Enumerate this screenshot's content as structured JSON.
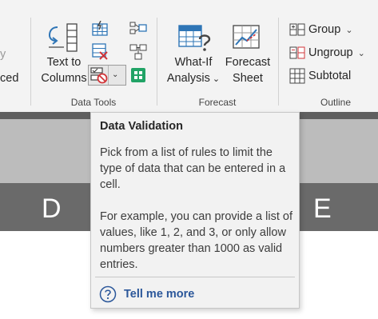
{
  "ribbon": {
    "left_fragments": {
      "top": "y",
      "bottom": "ced"
    },
    "groups": {
      "data_tools": "Data Tools",
      "forecast": "Forecast",
      "outline": "Outline"
    },
    "text_to_columns": {
      "line1": "Text to",
      "line2": "Columns"
    },
    "what_if": {
      "line1": "What-If",
      "line2": "Analysis"
    },
    "forecast_sheet": {
      "line1": "Forecast",
      "line2": "Sheet"
    },
    "outline_items": {
      "group": "Group",
      "ungroup": "Ungroup",
      "subtotal": "Subtotal"
    }
  },
  "columns": {
    "left": "D",
    "right": "E"
  },
  "tooltip": {
    "title": "Data Validation",
    "paragraph1": "Pick from a list of rules to limit the type of data that can be entered in a cell.",
    "paragraph2": "For example, you can provide a list of values, like 1, 2, and 3, or only allow numbers greater than 1000 as valid entries.",
    "link": "Tell me more"
  },
  "colors": {
    "accent_blue": "#2b579a",
    "icon_blue": "#2e75b6",
    "icon_red": "#d13438",
    "icon_green": "#21a366"
  }
}
